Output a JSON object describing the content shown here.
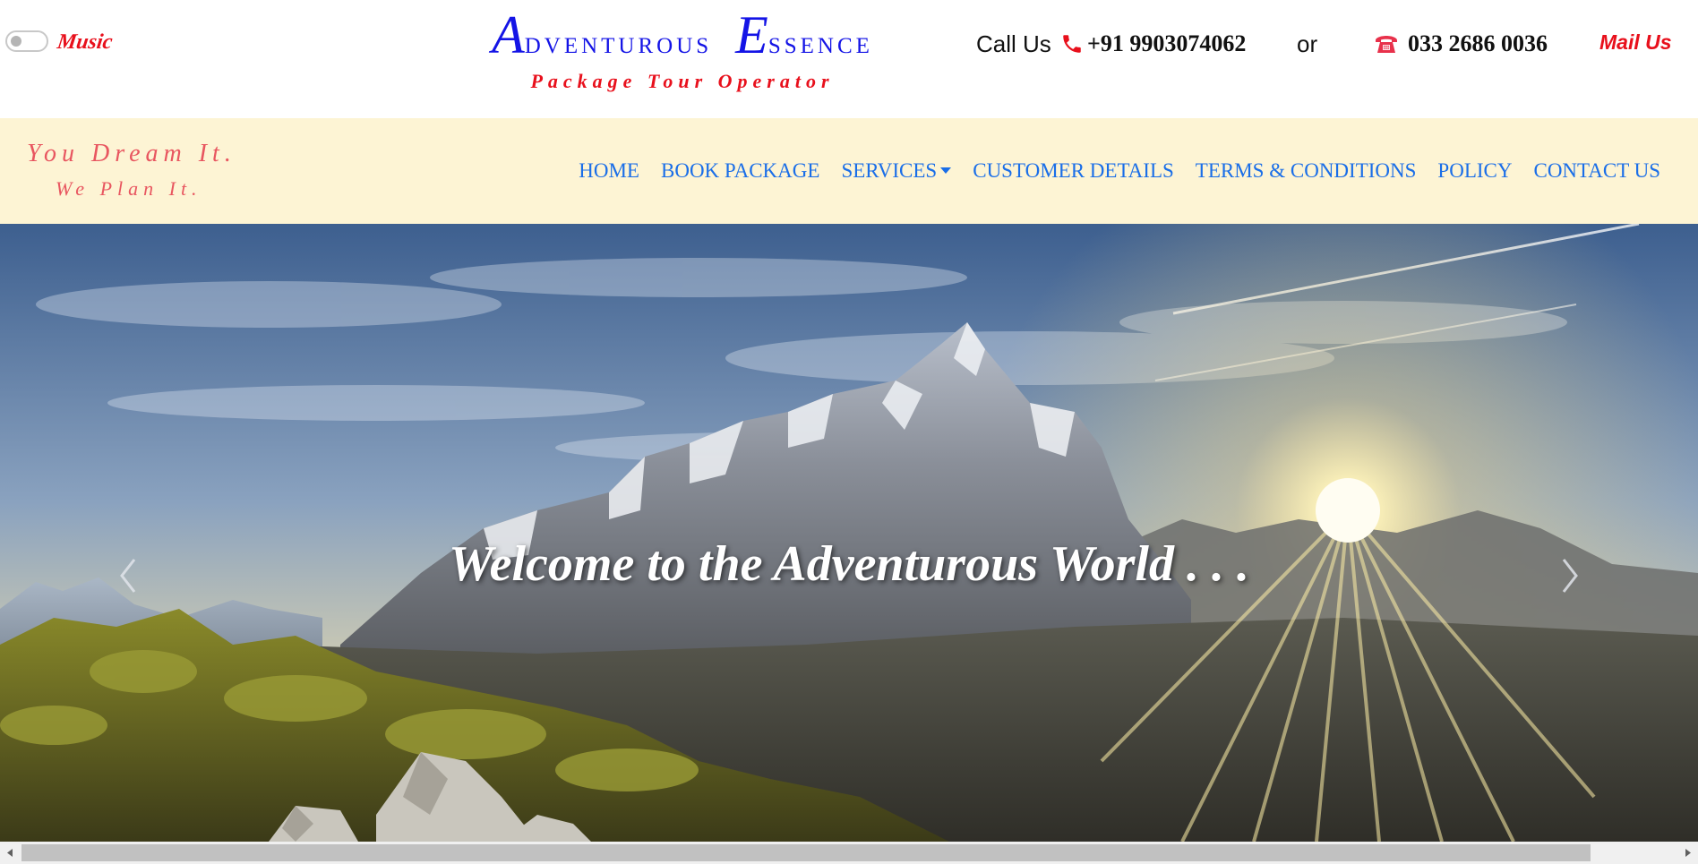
{
  "header": {
    "music_label": "Music",
    "brand": {
      "title_cap_1": "A",
      "title_rest_1": "dventurous",
      "title_cap_2": "E",
      "title_rest_2": "ssence",
      "subtitle": "Package Tour Operator"
    },
    "call_label": "Call Us",
    "mobile_number": "+91 9903074062",
    "or_text": "or",
    "landline_number": "033 2686 0036",
    "mail_label": "Mail Us"
  },
  "nav": {
    "tagline_line1": "You Dream It.",
    "tagline_line2": "We Plan It.",
    "items": [
      {
        "label": "HOME"
      },
      {
        "label": "BOOK PACKAGE"
      },
      {
        "label": "SERVICES"
      },
      {
        "label": "CUSTOMER DETAILS"
      },
      {
        "label": "TERMS & CONDITIONS"
      },
      {
        "label": "POLICY"
      },
      {
        "label": "CONTACT US"
      }
    ]
  },
  "hero": {
    "caption": "Welcome to the Adventurous World . . ."
  },
  "colors": {
    "brand_blue": "#1414e6",
    "accent_red": "#e8101c",
    "nav_link": "#1a6ee8",
    "nav_bg": "#fdf4d4",
    "tagline": "#e85660"
  },
  "icons": {
    "mobile": "phone-handset-icon",
    "landline": "telephone-icon",
    "prev": "chevron-left-icon",
    "next": "chevron-right-icon"
  }
}
